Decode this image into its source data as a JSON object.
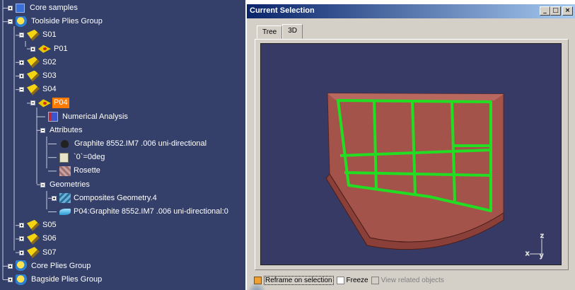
{
  "tree": {
    "items": [
      {
        "id": "core-samples",
        "label": "Core samples",
        "icon": "core-samples-icon",
        "level": 0,
        "toggle": "plus"
      },
      {
        "id": "toolside-group",
        "label": "Toolside Plies Group",
        "icon": "plies-group-icon",
        "level": 0,
        "toggle": "minus"
      },
      {
        "id": "s01",
        "label": "S01",
        "icon": "sequence-icon",
        "level": 1,
        "toggle": "minus"
      },
      {
        "id": "p01",
        "label": "P01",
        "icon": "ply-icon",
        "level": 2,
        "toggle": "plus"
      },
      {
        "id": "s02",
        "label": "S02",
        "icon": "sequence-icon",
        "level": 1,
        "toggle": "plus"
      },
      {
        "id": "s03",
        "label": "S03",
        "icon": "sequence-icon",
        "level": 1,
        "toggle": "plus"
      },
      {
        "id": "s04",
        "label": "S04",
        "icon": "sequence-icon",
        "level": 1,
        "toggle": "minus"
      },
      {
        "id": "p04",
        "label": "P04",
        "icon": "ply-icon",
        "level": 2,
        "toggle": "minus",
        "selected": true
      },
      {
        "id": "numerical-analysis",
        "label": "Numerical Analysis",
        "icon": "numerical-analysis-icon",
        "level": 3
      },
      {
        "id": "attributes",
        "label": "Attributes",
        "icon": "",
        "level": 3,
        "toggle": "minus"
      },
      {
        "id": "material",
        "label": "Graphite 8552.IM7 .006 uni-directional",
        "icon": "material-icon",
        "level": 4
      },
      {
        "id": "orientation",
        "label": "`0`=0deg",
        "icon": "parameter-icon",
        "level": 4
      },
      {
        "id": "rosette",
        "label": "Rosette",
        "icon": "rosette-icon",
        "level": 4
      },
      {
        "id": "geometries",
        "label": "Geometries",
        "icon": "",
        "level": 3,
        "toggle": "minus"
      },
      {
        "id": "composites-geometry",
        "label": "Composites Geometry.4",
        "icon": "composites-geometry-icon",
        "level": 4,
        "toggle": "plus"
      },
      {
        "id": "p04-surface",
        "label": "P04:Graphite 8552.IM7 .006 uni-directional:0",
        "icon": "surface-icon",
        "level": 4
      },
      {
        "id": "s05",
        "label": "S05",
        "icon": "sequence-icon",
        "level": 1,
        "toggle": "plus"
      },
      {
        "id": "s06",
        "label": "S06",
        "icon": "sequence-icon",
        "level": 1,
        "toggle": "plus"
      },
      {
        "id": "s07",
        "label": "S07",
        "icon": "sequence-icon",
        "level": 1,
        "toggle": "plus"
      },
      {
        "id": "core-group",
        "label": "Core Plies Group",
        "icon": "plies-group-icon",
        "level": 0,
        "toggle": "plus"
      },
      {
        "id": "bagside-group",
        "label": "Bagside Plies Group",
        "icon": "plies-group-icon",
        "level": 0,
        "toggle": "plus"
      }
    ]
  },
  "window": {
    "title": "Current Selection",
    "controls": {
      "minimize": "_",
      "maximize": "□",
      "close": "×"
    },
    "tabs": [
      {
        "label": "Tree",
        "active": false
      },
      {
        "label": "3D",
        "active": true
      }
    ],
    "viewport": {
      "background": "#373a64",
      "part_color": "#a0504a",
      "edge_color": "#22dd22",
      "axes": {
        "z": "z",
        "x": "x",
        "y": "y"
      }
    },
    "options": [
      {
        "label": "Reframe on selection",
        "checked": true,
        "enabled": true
      },
      {
        "label": "Freeze",
        "checked": false,
        "enabled": true
      },
      {
        "label": "View related objects",
        "checked": false,
        "enabled": false
      }
    ]
  }
}
